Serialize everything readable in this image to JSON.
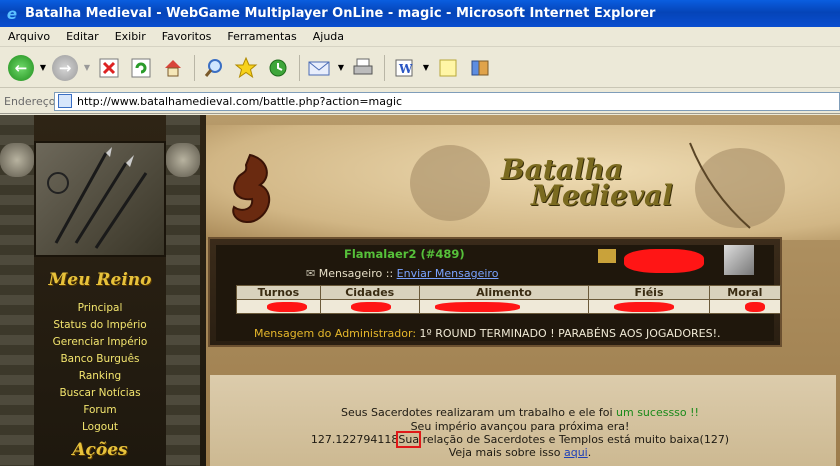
{
  "window": {
    "title": "Batalha Medieval - WebGame Multiplayer OnLine - magic - Microsoft Internet Explorer"
  },
  "menubar": [
    "Arquivo",
    "Editar",
    "Exibir",
    "Favoritos",
    "Ferramentas",
    "Ajuda"
  ],
  "toolbar": {
    "icons": [
      "back-icon",
      "forward-icon",
      "stop-icon",
      "refresh-icon",
      "home-icon",
      "search-icon",
      "favorites-icon",
      "history-icon",
      "mail-icon",
      "print-icon",
      "edit-icon",
      "discuss-icon",
      "messenger-icon"
    ]
  },
  "address": {
    "label": "Endereço",
    "url": "http://www.batalhamedieval.com/battle.php?action=magic"
  },
  "site": {
    "banner_title_1": "Batalha",
    "banner_title_2": "Medieval",
    "sidebar": {
      "heading": "Meu Reino",
      "links": [
        "Principal",
        "Status do Império",
        "Gerenciar Império",
        "Banco Burguês",
        "Ranking",
        "Buscar Notícias",
        "Forum",
        "Logout"
      ],
      "heading2": "Ações"
    },
    "player": {
      "name": "Flamalaer2 (#489)",
      "messenger_label": "Mensageiro ::",
      "messenger_link": "Enviar Mensageiro"
    },
    "stats": {
      "columns": [
        "Turnos",
        "Cidades",
        "Alimento",
        "Fiéis",
        "Moral"
      ]
    },
    "admin": {
      "label": "Mensagem do Administrador:",
      "text": "1º ROUND TERMINADO ! PARABÉNS AOS JOGADORES!."
    },
    "content": {
      "line1_a": "Seus Sacerdotes realizaram um trabalho e ele foi",
      "line1_b": "um sucessso !!",
      "line2": "Seu império avançou para próxima era!",
      "line3_num": "127.122794118",
      "line3_hl": "Sua",
      "line3_rest": " relação de Sacerdotes e Templos está muito baixa(127)",
      "line4_a": "Veja mais sobre isso",
      "line4_link": "aqui",
      "line4_end": "."
    }
  }
}
